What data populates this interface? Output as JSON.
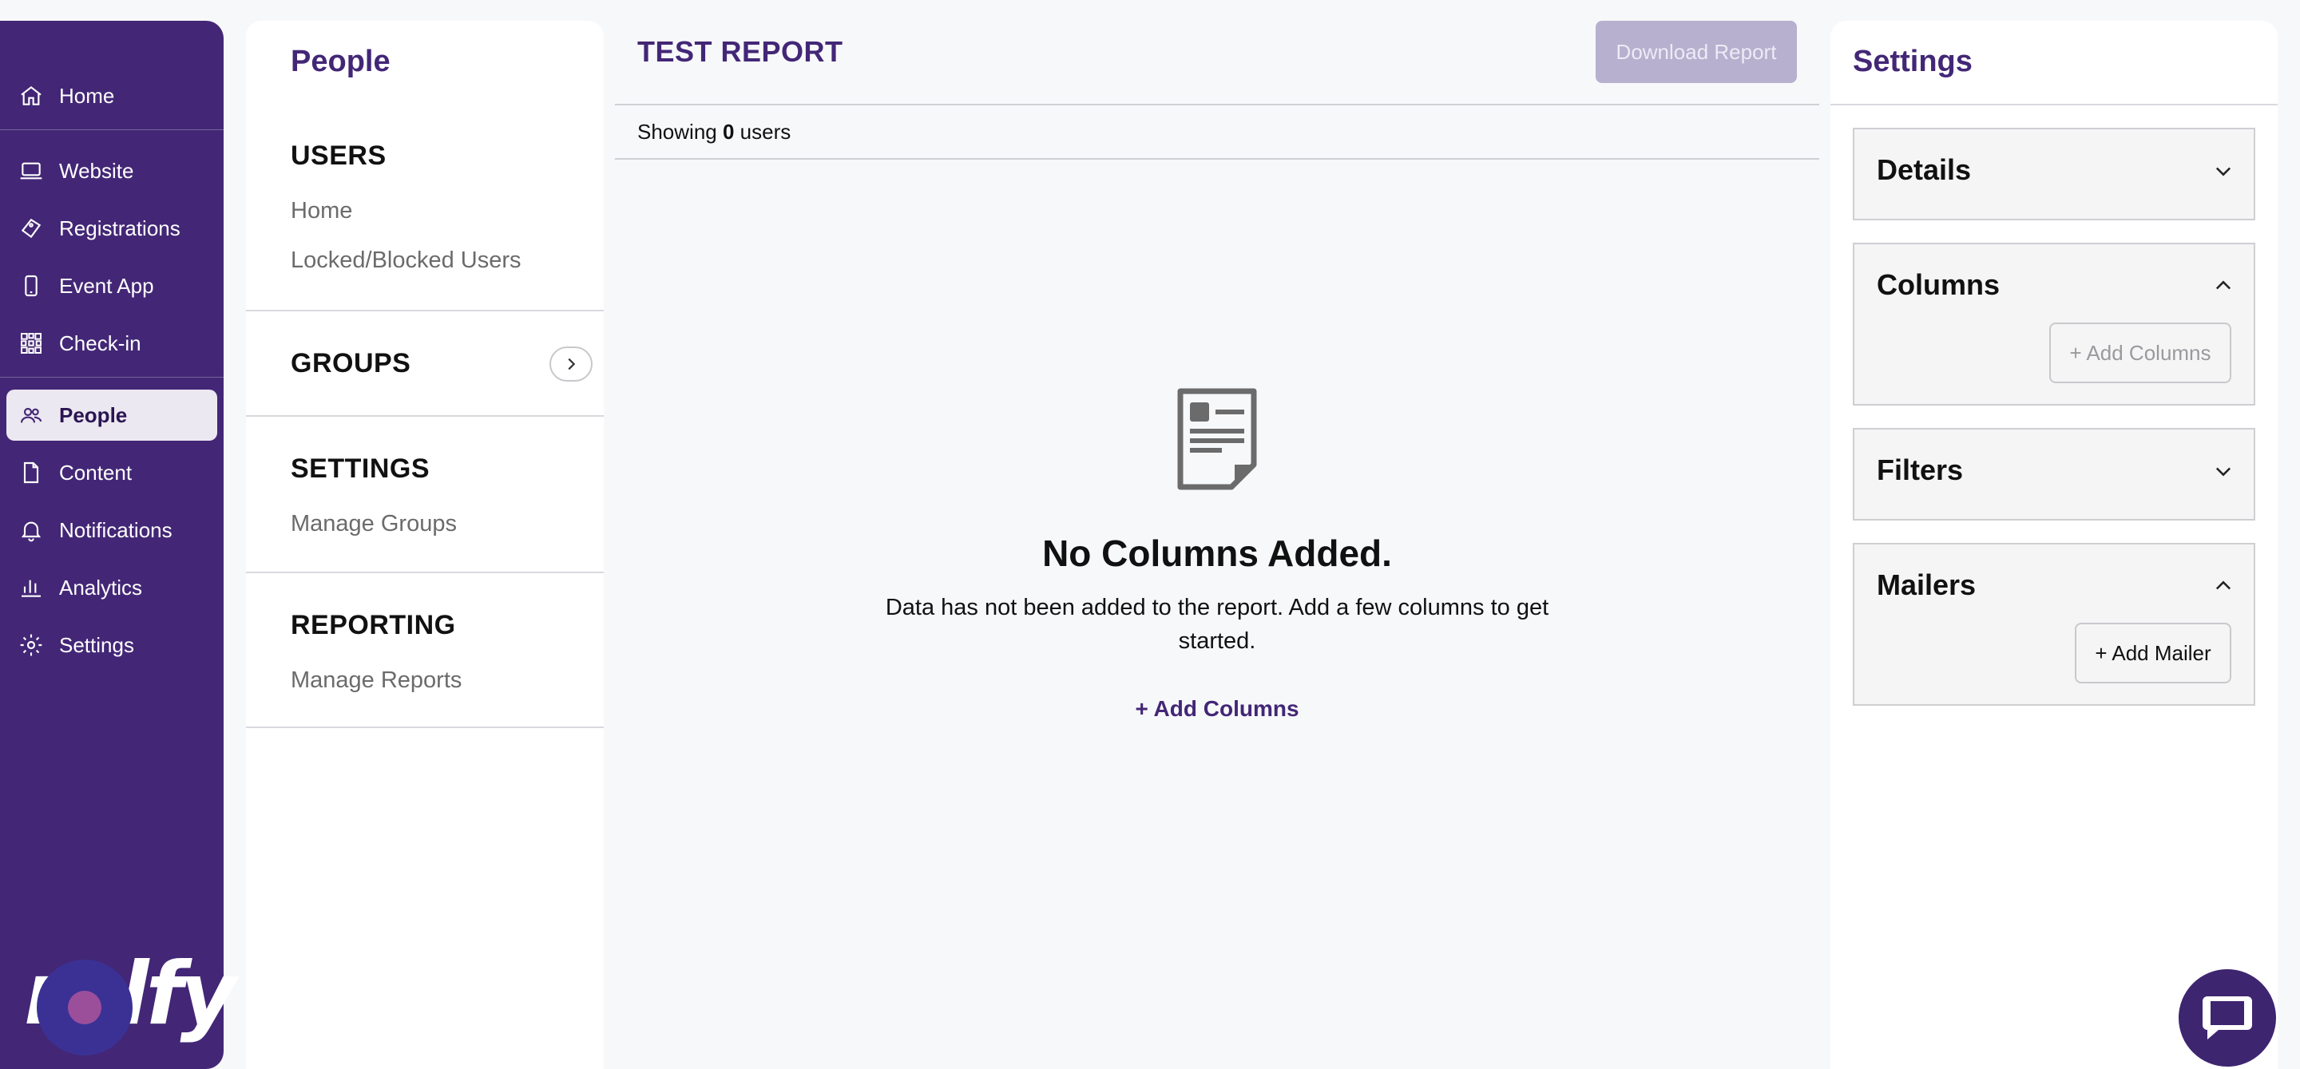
{
  "nav": {
    "items": [
      {
        "label": "Home",
        "icon": "home-icon"
      },
      {
        "label": "Website",
        "icon": "laptop-icon"
      },
      {
        "label": "Registrations",
        "icon": "ticket-icon"
      },
      {
        "label": "Event App",
        "icon": "phone-icon"
      },
      {
        "label": "Check-in",
        "icon": "qr-code-icon"
      },
      {
        "label": "People",
        "icon": "people-icon",
        "active": true
      },
      {
        "label": "Content",
        "icon": "document-icon"
      },
      {
        "label": "Notifications",
        "icon": "bell-icon"
      },
      {
        "label": "Analytics",
        "icon": "bar-chart-icon"
      },
      {
        "label": "Settings",
        "icon": "gear-icon"
      }
    ],
    "logo_text": "rolfy",
    "bg_color": "#432776"
  },
  "subpanel": {
    "title": "People",
    "users_heading": "USERS",
    "users_home": "Home",
    "users_locked": "Locked/Blocked Users",
    "groups_heading": "GROUPS",
    "settings_heading": "SETTINGS",
    "manage_groups": "Manage Groups",
    "reporting_heading": "REPORTING",
    "manage_reports": "Manage Reports"
  },
  "report": {
    "title": "TEST REPORT",
    "download_label": "Download Report",
    "showing_prefix": "Showing",
    "showing_count": "0",
    "showing_suffix": "users",
    "empty_title": "No Columns Added.",
    "empty_desc": "Data has not been added to the report. Add a few columns to get started.",
    "add_columns_link": "+ Add Columns"
  },
  "settings": {
    "title": "Settings",
    "details": {
      "label": "Details",
      "expanded": false
    },
    "columns": {
      "label": "Columns",
      "expanded": true,
      "button": "+ Add Columns"
    },
    "filters": {
      "label": "Filters",
      "expanded": false
    },
    "mailers": {
      "label": "Mailers",
      "expanded": true,
      "button": "+ Add Mailer"
    }
  },
  "colors": {
    "accent": "#432776",
    "disabled_button": "#b7b0ce"
  }
}
